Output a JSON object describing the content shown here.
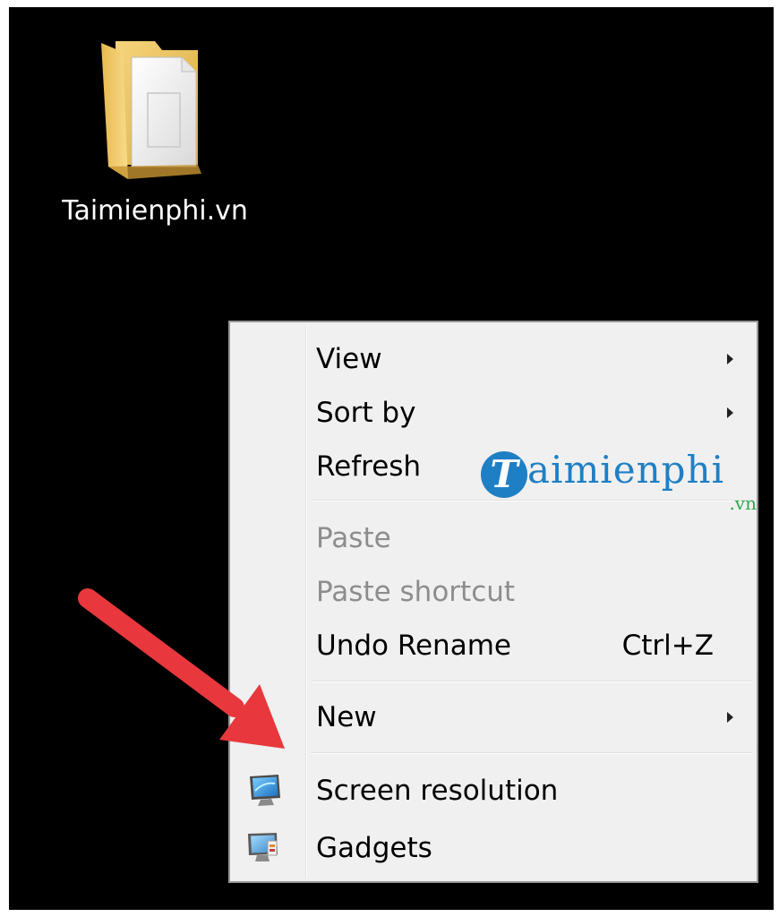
{
  "desktop": {
    "background": "#000000",
    "icons": [
      {
        "label": "Taimienphi.vn",
        "icon": "folder-icon"
      }
    ]
  },
  "context_menu": {
    "items": [
      {
        "label": "View",
        "has_submenu": true
      },
      {
        "label": "Sort by",
        "has_submenu": true
      },
      {
        "label": "Refresh"
      },
      {
        "label": "Paste",
        "disabled": true
      },
      {
        "label": "Paste shortcut",
        "disabled": true
      },
      {
        "label": "Undo Rename",
        "shortcut": "Ctrl+Z"
      },
      {
        "label": "New",
        "has_submenu": true
      },
      {
        "label": "Screen resolution",
        "icon": "monitor-icon"
      },
      {
        "label": "Gadgets",
        "icon": "gadgets-icon"
      }
    ]
  },
  "watermark": {
    "letter": "T",
    "text": "aimienphi",
    "tld": ".vn",
    "colors": {
      "primary": "#1f7fc4",
      "tld": "#2fa84f"
    }
  },
  "annotation": {
    "type": "arrow",
    "color": "#e8383d",
    "points_to": "Screen resolution"
  }
}
